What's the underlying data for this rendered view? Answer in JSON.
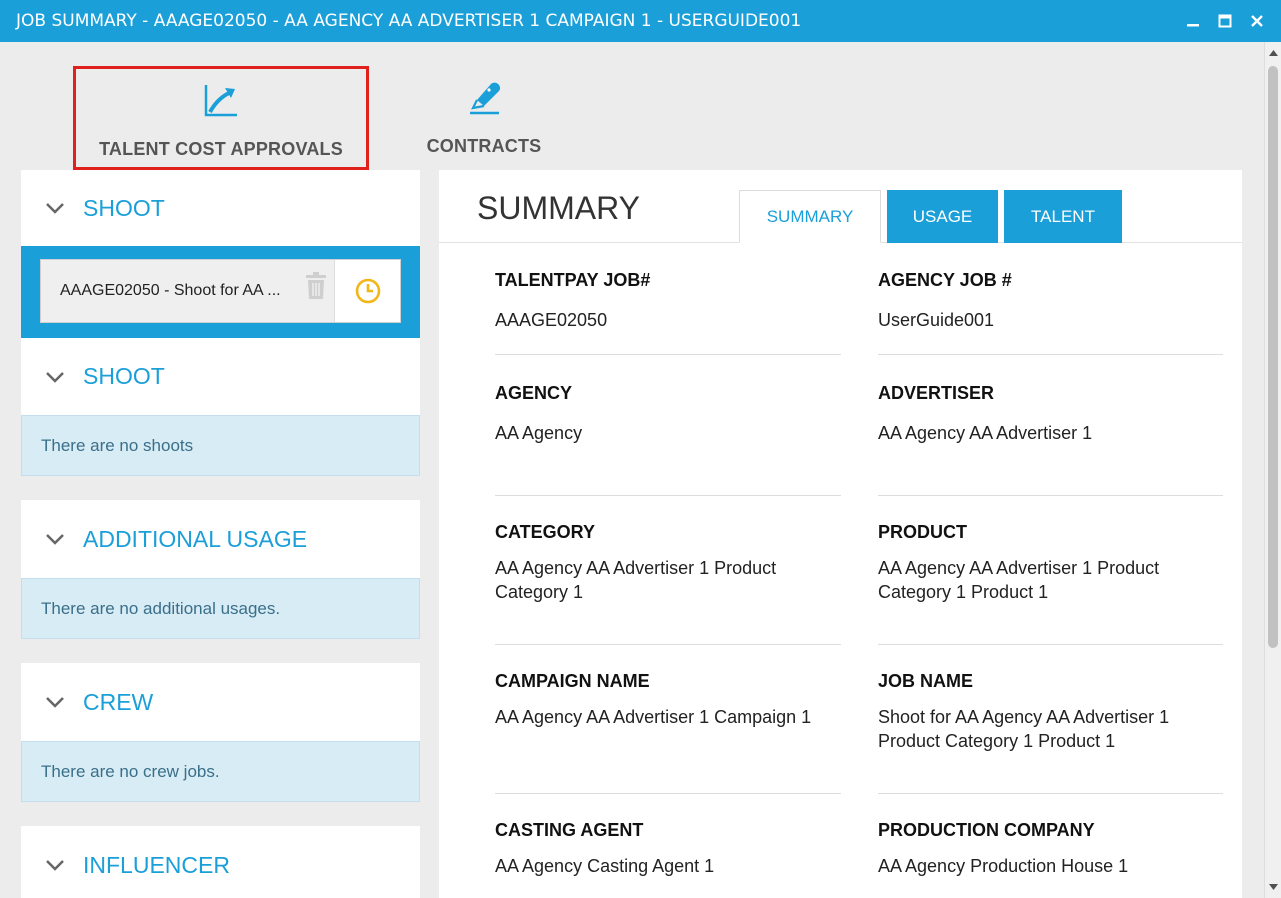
{
  "window": {
    "title": "JOB SUMMARY - AAAGE02050 - AA AGENCY AA ADVERTISER 1 CAMPAIGN 1 - USERGUIDE001"
  },
  "toolbar": {
    "approvals_label": "TALENT COST APPROVALS",
    "contracts_label": "CONTRACTS"
  },
  "left": {
    "shoot1_title": "SHOOT",
    "shoot_item_label": "AAAGE02050 - Shoot for AA ...",
    "shoot2_title": "SHOOT",
    "shoot2_empty": "There are no shoots",
    "additional_title": "ADDITIONAL USAGE",
    "additional_empty": "There are no additional usages.",
    "crew_title": "CREW",
    "crew_empty": "There are no crew jobs.",
    "influencer_title": "INFLUENCER"
  },
  "panel": {
    "title": "SUMMARY",
    "tabs": [
      "SUMMARY",
      "USAGE",
      "TALENT"
    ],
    "fields": [
      {
        "label": "TALENTPAY JOB#",
        "value": "AAAGE02050"
      },
      {
        "label": "AGENCY JOB #",
        "value": "UserGuide001"
      },
      {
        "label": "AGENCY",
        "value": "AA Agency"
      },
      {
        "label": "ADVERTISER",
        "value": "AA Agency AA Advertiser 1"
      },
      {
        "label": "CATEGORY",
        "value": "AA Agency AA Advertiser 1 Product Category 1"
      },
      {
        "label": "PRODUCT",
        "value": "AA Agency AA Advertiser 1 Product Category 1 Product 1"
      },
      {
        "label": "CAMPAIGN NAME",
        "value": "AA Agency AA Advertiser 1 Campaign 1"
      },
      {
        "label": "JOB NAME",
        "value": "Shoot for AA Agency AA Advertiser 1 Product Category 1 Product 1"
      },
      {
        "label": "CASTING AGENT",
        "value": "AA Agency Casting Agent 1"
      },
      {
        "label": "PRODUCTION COMPANY",
        "value": "AA Agency Production House 1"
      }
    ]
  },
  "colors": {
    "accent": "#1a9fd9",
    "highlight_border": "#e0201c",
    "clock": "#f2b619"
  }
}
